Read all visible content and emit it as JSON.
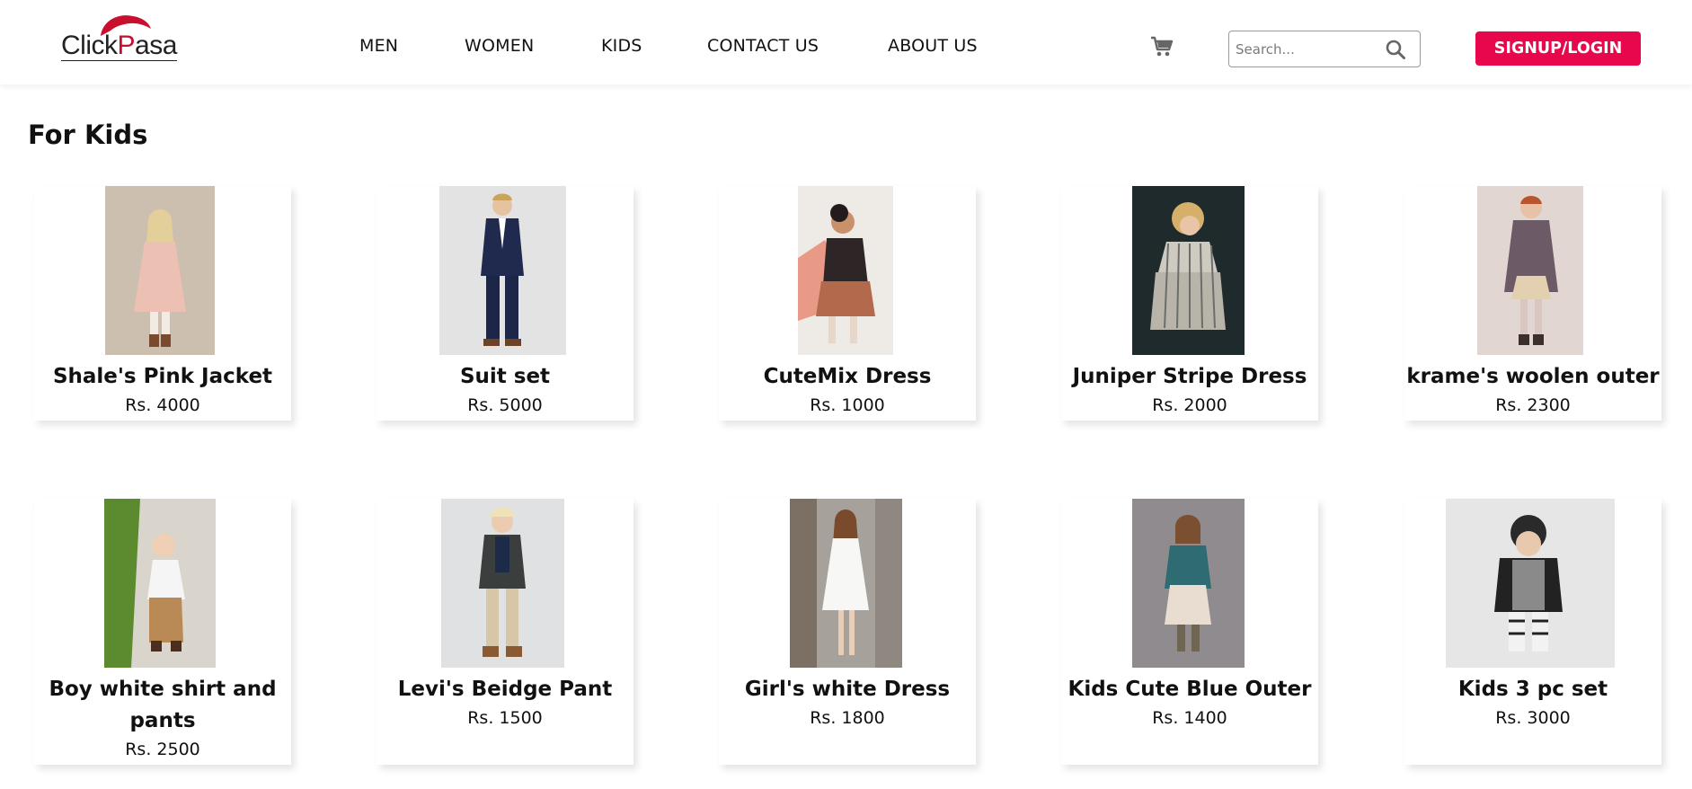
{
  "header": {
    "logo": {
      "text_main": "Click",
      "text_tail": "asa",
      "text_accent": "P"
    },
    "nav": [
      {
        "label": "MEN"
      },
      {
        "label": "WOMEN"
      },
      {
        "label": "KIDS"
      },
      {
        "label": "CONTACT US"
      },
      {
        "label": "ABOUT US"
      }
    ],
    "cart_icon": "shopping-cart-icon",
    "search": {
      "placeholder": "Search...",
      "value": "",
      "icon": "search-icon"
    },
    "signup_label": "SIGNUP/LOGIN"
  },
  "main": {
    "section_title": "For Kids",
    "products": [
      {
        "name": "Shale's Pink Jacket",
        "price": "Rs. 4000"
      },
      {
        "name": "Suit set",
        "price": "Rs. 5000"
      },
      {
        "name": "CuteMix Dress",
        "price": "Rs. 1000"
      },
      {
        "name": "Juniper Stripe Dress",
        "price": "Rs. 2000"
      },
      {
        "name": "krame's woolen outer",
        "price": "Rs. 2300"
      },
      {
        "name": "Boy white shirt and pants",
        "price": "Rs. 2500"
      },
      {
        "name": "Levi's Beidge Pant",
        "price": "Rs. 1500"
      },
      {
        "name": "Girl's white Dress",
        "price": "Rs. 1800"
      },
      {
        "name": "Kids Cute Blue Outer",
        "price": "Rs. 1400"
      },
      {
        "name": "Kids 3 pc set",
        "price": "Rs. 3000"
      }
    ]
  },
  "colors": {
    "accent": "#e8064d",
    "logo_red": "#c8102e",
    "text": "#111111"
  }
}
